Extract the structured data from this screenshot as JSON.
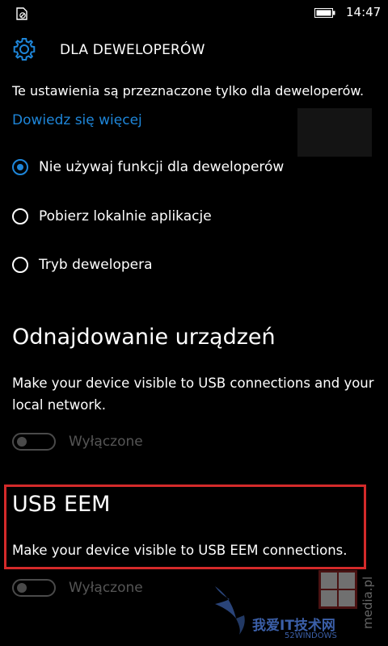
{
  "status_bar": {
    "time": "14:47",
    "left_icon": "no-sim-icon",
    "battery_icon": "battery-icon"
  },
  "header": {
    "icon": "gear-icon",
    "title": "DLA DEWELOPERÓW"
  },
  "intro": {
    "text": "Te ustawienia są przeznaczone tylko dla deweloperów.",
    "link": "Dowiedz się więcej"
  },
  "developer_options": [
    {
      "label": "Nie używaj funkcji dla deweloperów",
      "checked": true
    },
    {
      "label": "Pobierz lokalnie aplikacje",
      "checked": false
    },
    {
      "label": "Tryb dewelopera",
      "checked": false
    }
  ],
  "device_discovery": {
    "title": "Odnajdowanie urządzeń",
    "description": "Make your device visible to USB connections and your local network.",
    "toggle_label": "Wyłączone",
    "toggle_on": false
  },
  "usb_eem": {
    "title": "USB EEM",
    "description": "Make your device visible to USB EEM connections.",
    "toggle_label": "Wyłączone",
    "toggle_on": false
  },
  "watermark": {
    "text": "我爱IT技术网",
    "subtext": "52WINDOWS",
    "side_text": "media.pl"
  },
  "colors": {
    "accent": "#1e86d9",
    "highlight_border": "#d42a2a",
    "background": "#000000",
    "disabled": "#4a4a4a"
  }
}
